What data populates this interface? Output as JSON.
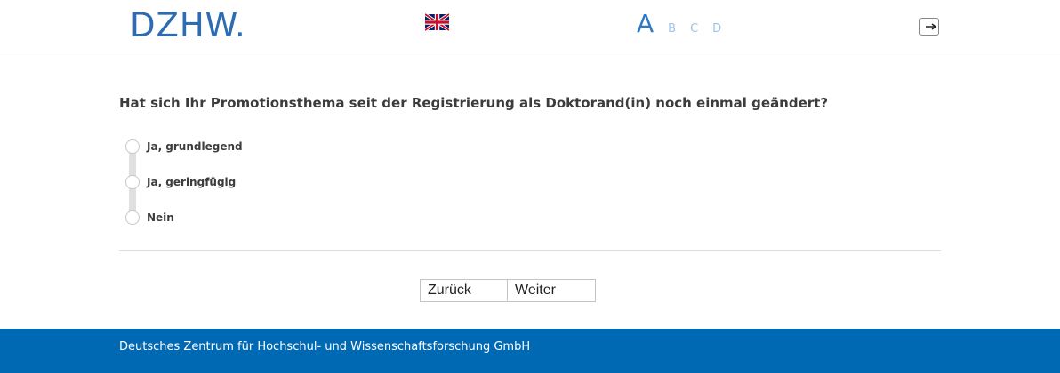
{
  "header": {
    "logo_text": "DZHW.",
    "language_flag": "uk-flag-icon",
    "font_size_options": [
      "A",
      "B",
      "C",
      "D"
    ],
    "logout_icon": "logout-icon"
  },
  "question": {
    "text": "Hat sich Ihr Promotionsthema seit der Registrierung als Doktorand(in) noch einmal geändert?",
    "options": [
      {
        "label": "Ja, grundlegend"
      },
      {
        "label": "Ja, geringfügig"
      },
      {
        "label": "Nein"
      }
    ]
  },
  "navigation": {
    "back_label": "Zurück",
    "next_label": "Weiter"
  },
  "footer": {
    "text": "Deutsches Zentrum für Hochschul- und Wissenschaftsforschung GmbH"
  },
  "colors": {
    "brand": "#2d6cb3",
    "footer_bg": "#0069b4",
    "accent_light": "#9cc3ea"
  }
}
